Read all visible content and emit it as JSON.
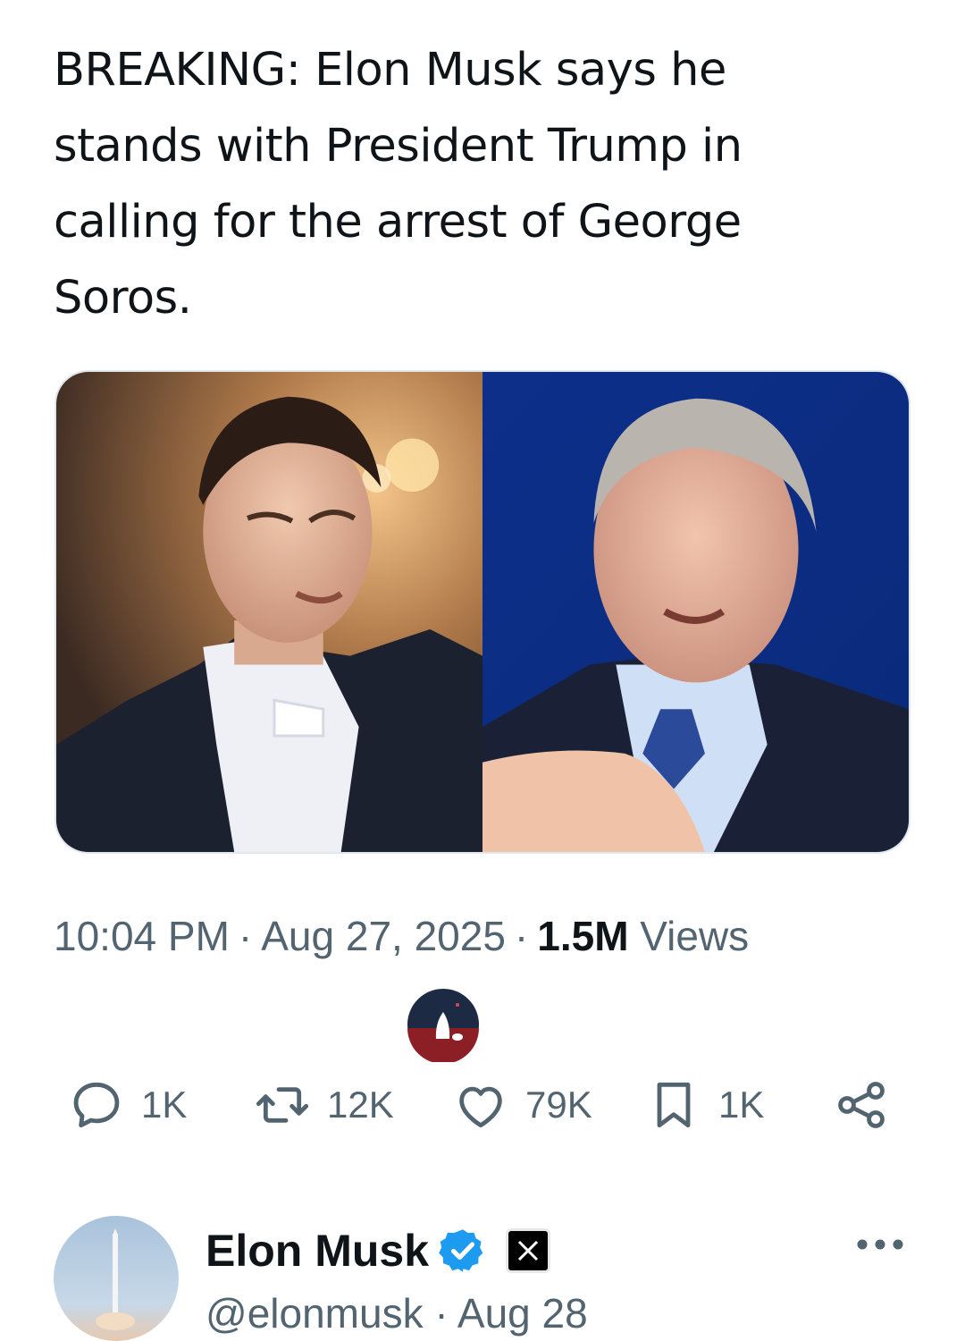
{
  "tweet": {
    "text": "BREAKING: Elon Musk says he stands with President Trump in calling for the arrest of George Soros.",
    "time": "10:04 PM",
    "date": "Aug 27, 2025",
    "separator": "·",
    "views_count": "1.5M",
    "views_label": "Views"
  },
  "actions": {
    "reply_count": "1K",
    "retweet_count": "12K",
    "like_count": "79K",
    "bookmark_count": "1K"
  },
  "author": {
    "name": "Elon Musk",
    "handle": "@elonmusk · Aug 28"
  },
  "colors": {
    "text": "#0f1419",
    "muted": "#536471",
    "verified": "#1d9bf0"
  },
  "icons": [
    "reply-icon",
    "retweet-icon",
    "like-icon",
    "bookmark-icon",
    "share-icon",
    "verified-icon",
    "x-logo-icon",
    "more-icon"
  ]
}
